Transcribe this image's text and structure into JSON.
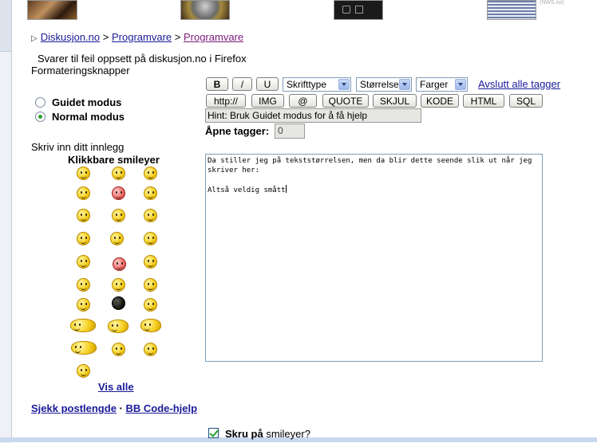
{
  "thumbnails": {
    "caption": "(NWS.no)"
  },
  "breadcrumb": {
    "home": "Diskusjon.no",
    "sep": ">",
    "level1": "Programvare",
    "level2": "Programvare"
  },
  "topic_title": "Svarer til feil oppsett på diskusjon.no i Firefox",
  "formatting_label": "Formateringsknapper",
  "modes": {
    "guided": "Guidet modus",
    "normal": "Normal modus",
    "selected": "normal"
  },
  "toolbar": {
    "bold": "B",
    "italic": "/",
    "underline": "U",
    "font_select": "Skrifttype",
    "size_select": "Størrelse",
    "color_select": "Farger",
    "close_all": "Avslutt alle tagger",
    "http": "http://",
    "img": "IMG",
    "email": "@",
    "quote": "QUOTE",
    "hide": "SKJUL",
    "code": "KODE",
    "html": "HTML",
    "sql": "SQL"
  },
  "hint": "Hint: Bruk Guidet modus for å få hjelp",
  "open_tags": {
    "label": "Åpne tagger:",
    "value": "0"
  },
  "write_label": "Skriv inn ditt innlegg",
  "smileys": {
    "title": "Klikkbare smileyer",
    "show_all": "Vis alle"
  },
  "message": "Da stiller jeg på tekststørrelsen, men da blir dette seende slik ut når jeg skriver her:\n\nAltså veldig smått",
  "links": {
    "check_length": "Sjekk postlengde",
    "dot": "·",
    "bbcode_help": "BB Code-hjelp"
  },
  "options": {
    "enable_smileys": "Skru på smileyer?",
    "enable_smileys_bold": "Skru på",
    "enable_smileys_rest": "smileyer?"
  }
}
